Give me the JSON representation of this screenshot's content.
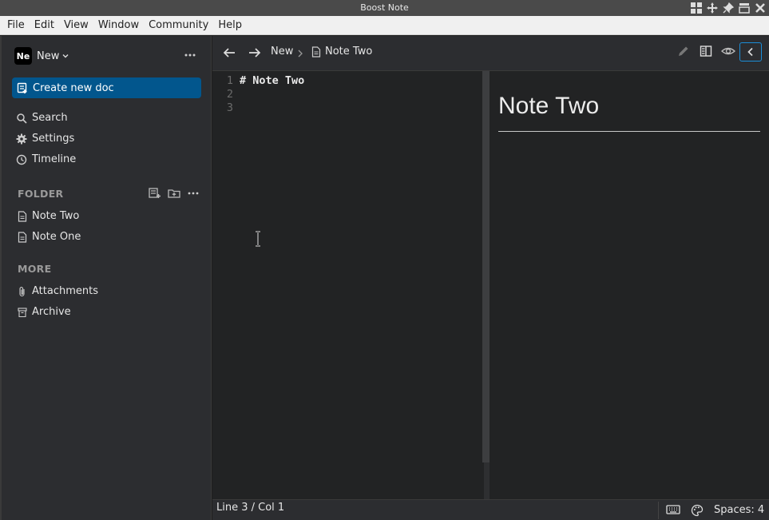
{
  "window": {
    "title": "Boost Note"
  },
  "menu": [
    "File",
    "Edit",
    "View",
    "Window",
    "Community",
    "Help"
  ],
  "sidebar": {
    "workspace": {
      "logo_text": "Ne",
      "name": "New"
    },
    "create_button": "Create new doc",
    "nav": [
      {
        "label": "Search",
        "icon": "search-icon"
      },
      {
        "label": "Settings",
        "icon": "gear-icon"
      },
      {
        "label": "Timeline",
        "icon": "clock-icon"
      }
    ],
    "folder_section": "FOLDER",
    "docs": [
      {
        "label": "Note Two",
        "icon": "document-icon"
      },
      {
        "label": "Note One",
        "icon": "document-icon"
      }
    ],
    "more_section": "MORE",
    "more_items": [
      {
        "label": "Attachments",
        "icon": "paperclip-icon"
      },
      {
        "label": "Archive",
        "icon": "archive-icon"
      }
    ]
  },
  "toolbar": {
    "breadcrumb_workspace": "New",
    "breadcrumb_doc": "Note Two"
  },
  "editor": {
    "lines": [
      {
        "num": "1",
        "text": "# Note Two"
      },
      {
        "num": "2",
        "text": ""
      },
      {
        "num": "3",
        "text": ""
      }
    ]
  },
  "preview": {
    "heading": "Note Two"
  },
  "status": {
    "position": "Line 3 / Col 1",
    "indent": "Spaces: 4"
  },
  "colors": {
    "accent": "#02568d",
    "focus_border": "#1b8ed8"
  }
}
